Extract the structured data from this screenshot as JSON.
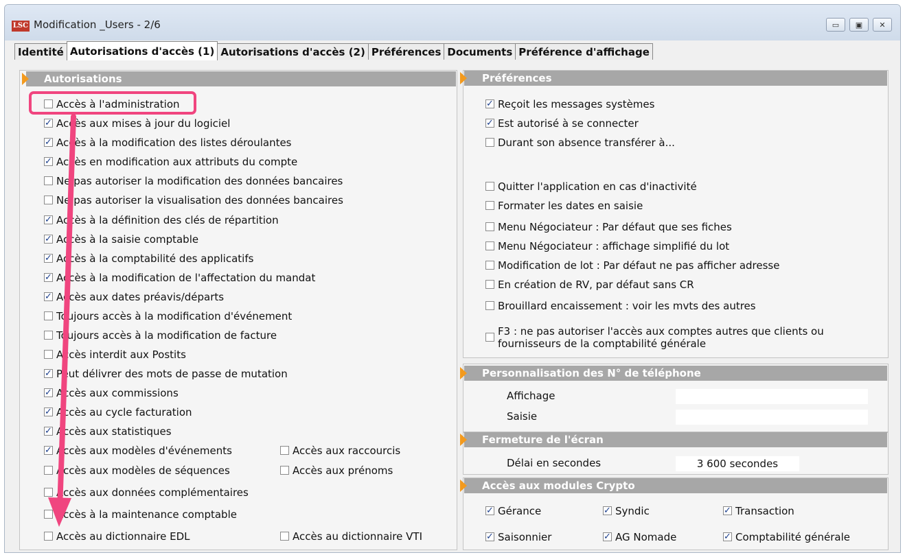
{
  "window": {
    "title": "Modification _Users - 2/6",
    "logo": "LSC"
  },
  "controls": {
    "minimize": "▭",
    "maximize": "▣",
    "close": "✕"
  },
  "tabs": [
    {
      "label": "Identité"
    },
    {
      "label": "Autorisations d'accès (1)"
    },
    {
      "label": "Autorisations d'accès (2)"
    },
    {
      "label": "Préférences"
    },
    {
      "label": "Documents"
    },
    {
      "label": "Préférence d'affichage"
    }
  ],
  "autorisations": {
    "header": "Autorisations",
    "items": [
      {
        "label": "Accès à l'administration",
        "checked": false
      },
      {
        "label": "Accès aux mises à jour du logiciel",
        "checked": true
      },
      {
        "label": "Accès à la modification des listes déroulantes",
        "checked": true
      },
      {
        "label": "Accès en modification aux attributs du compte",
        "checked": true
      },
      {
        "label": "Ne pas autoriser la modification des données bancaires",
        "checked": false
      },
      {
        "label": "Ne pas autoriser la visualisation des données bancaires",
        "checked": false
      },
      {
        "label": "Accès à la définition des clés de répartition",
        "checked": true
      },
      {
        "label": "Accès à la saisie comptable",
        "checked": true
      },
      {
        "label": "Accès à la comptabilité des applicatifs",
        "checked": true
      },
      {
        "label": "Accès à la modification de l'affectation du mandat",
        "checked": true
      },
      {
        "label": "Accès aux dates préavis/départs",
        "checked": true
      },
      {
        "label": "Toujours accès à la modification d'événement",
        "checked": false
      },
      {
        "label": "Toujours accès à la modification de facture",
        "checked": false
      },
      {
        "label": "Accès interdit aux Postits",
        "checked": false
      },
      {
        "label": "Peut délivrer des mots de passe de mutation",
        "checked": true
      },
      {
        "label": "Accès aux commissions",
        "checked": true
      },
      {
        "label": "Accès au cycle facturation",
        "checked": true
      },
      {
        "label": "Accès aux statistiques",
        "checked": true
      },
      {
        "label": "Accès aux modèles d'événements",
        "checked": true
      },
      {
        "label": "Accès aux modèles de séquences",
        "checked": false
      },
      {
        "label": "Accès aux données complémentaires",
        "checked": false
      },
      {
        "label": "Accès à la maintenance comptable",
        "checked": false
      },
      {
        "label": "Accès au dictionnaire EDL",
        "checked": false
      }
    ],
    "side_items": [
      {
        "label": "Accès aux raccourcis",
        "checked": false
      },
      {
        "label": "Accès aux prénoms",
        "checked": false
      },
      {
        "label": "Accès au dictionnaire VTI",
        "checked": false
      }
    ]
  },
  "preferences": {
    "header": "Préférences",
    "items": [
      {
        "label": "Reçoit les messages systèmes",
        "checked": true
      },
      {
        "label": "Est autorisé à se connecter",
        "checked": true
      },
      {
        "label": "Durant son absence transférer à...",
        "checked": false
      },
      {
        "label": "Quitter l'application en cas d'inactivité",
        "checked": false
      },
      {
        "label": "Formater les dates en saisie",
        "checked": false
      },
      {
        "label": "Menu Négociateur : Par défaut que ses fiches",
        "checked": false
      },
      {
        "label": "Menu Négociateur : affichage simplifié du lot",
        "checked": false
      },
      {
        "label": "Modification de lot : Par défaut ne pas afficher adresse",
        "checked": false
      },
      {
        "label": "En création de RV, par défaut sans CR",
        "checked": false
      },
      {
        "label": "Brouillard encaissement : voir les mvts des autres",
        "checked": false
      },
      {
        "label": "F3 : ne pas autoriser l'accès aux comptes autres que clients ou",
        "label2": "fournisseurs de la comptabilité générale",
        "checked": false
      }
    ]
  },
  "telephone": {
    "header": "Personnalisation des N° de téléphone",
    "affichage_label": "Affichage",
    "affichage_value": "",
    "saisie_label": "Saisie",
    "saisie_value": ""
  },
  "fermeture": {
    "header": "Fermeture de l'écran",
    "delai_label": "Délai en secondes",
    "delai_value": "3 600 secondes"
  },
  "crypto": {
    "header": "Accès aux modules Crypto",
    "items": [
      {
        "label": "Gérance",
        "checked": true
      },
      {
        "label": "Syndic",
        "checked": true
      },
      {
        "label": "Transaction",
        "checked": true
      },
      {
        "label": "Saisonnier",
        "checked": true
      },
      {
        "label": "AG Nomade",
        "checked": true
      },
      {
        "label": "Comptabilité générale",
        "checked": true
      }
    ]
  },
  "annotation": {
    "highlight_color": "#f0457f"
  }
}
